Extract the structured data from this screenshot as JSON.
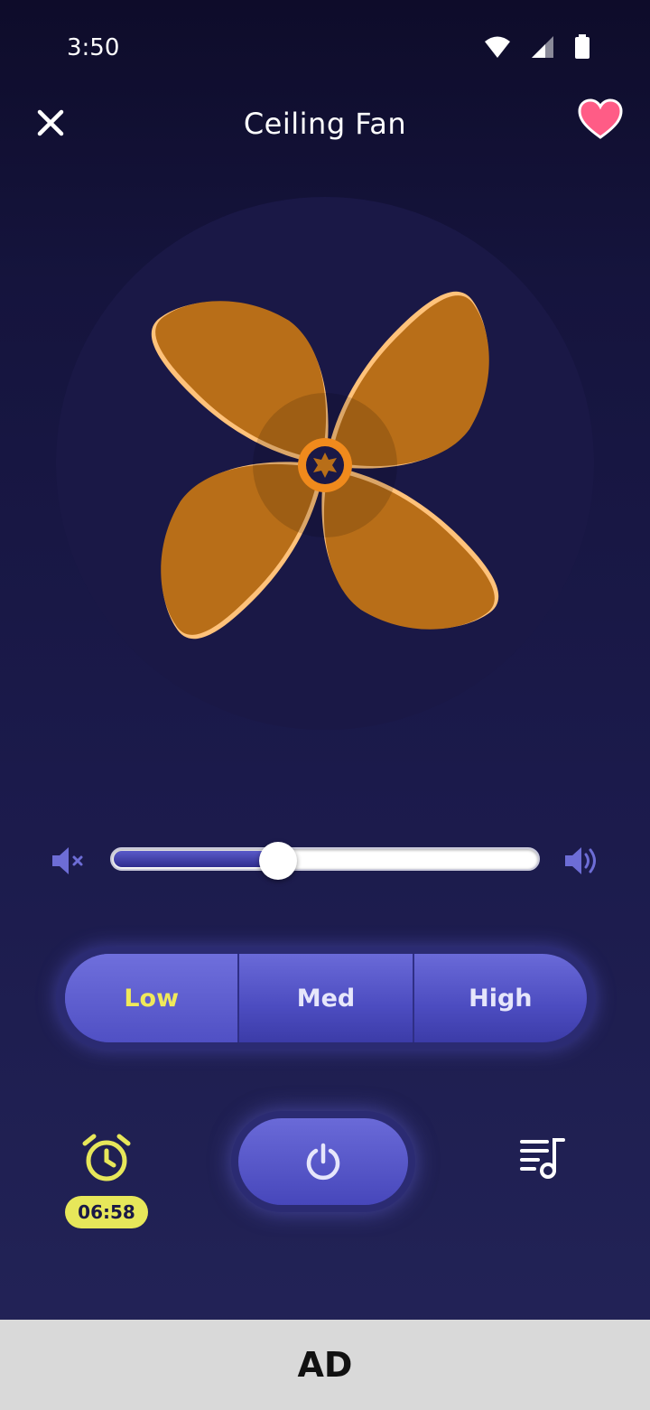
{
  "status_bar": {
    "time": "3:50"
  },
  "header": {
    "title": "Ceiling Fan"
  },
  "volume": {
    "level": 0.39
  },
  "speed": {
    "options": [
      "Low",
      "Med",
      "High"
    ],
    "selected": "Low"
  },
  "timer": {
    "value": "06:58"
  },
  "ad": {
    "label": "AD"
  },
  "colors": {
    "accent": "#5a5ac9",
    "blade": "#b86e18",
    "blade_edge": "#ffc27a",
    "hub": "#f08a1c",
    "timer_yellow": "#e7e75a",
    "heart": "#ff5c86"
  },
  "icons": {
    "close": "close-icon",
    "favorite": "heart-icon",
    "mute": "volume-mute-icon",
    "volume_up": "volume-up-icon",
    "timer": "alarm-clock-icon",
    "power": "power-icon",
    "playlist": "playlist-icon"
  }
}
